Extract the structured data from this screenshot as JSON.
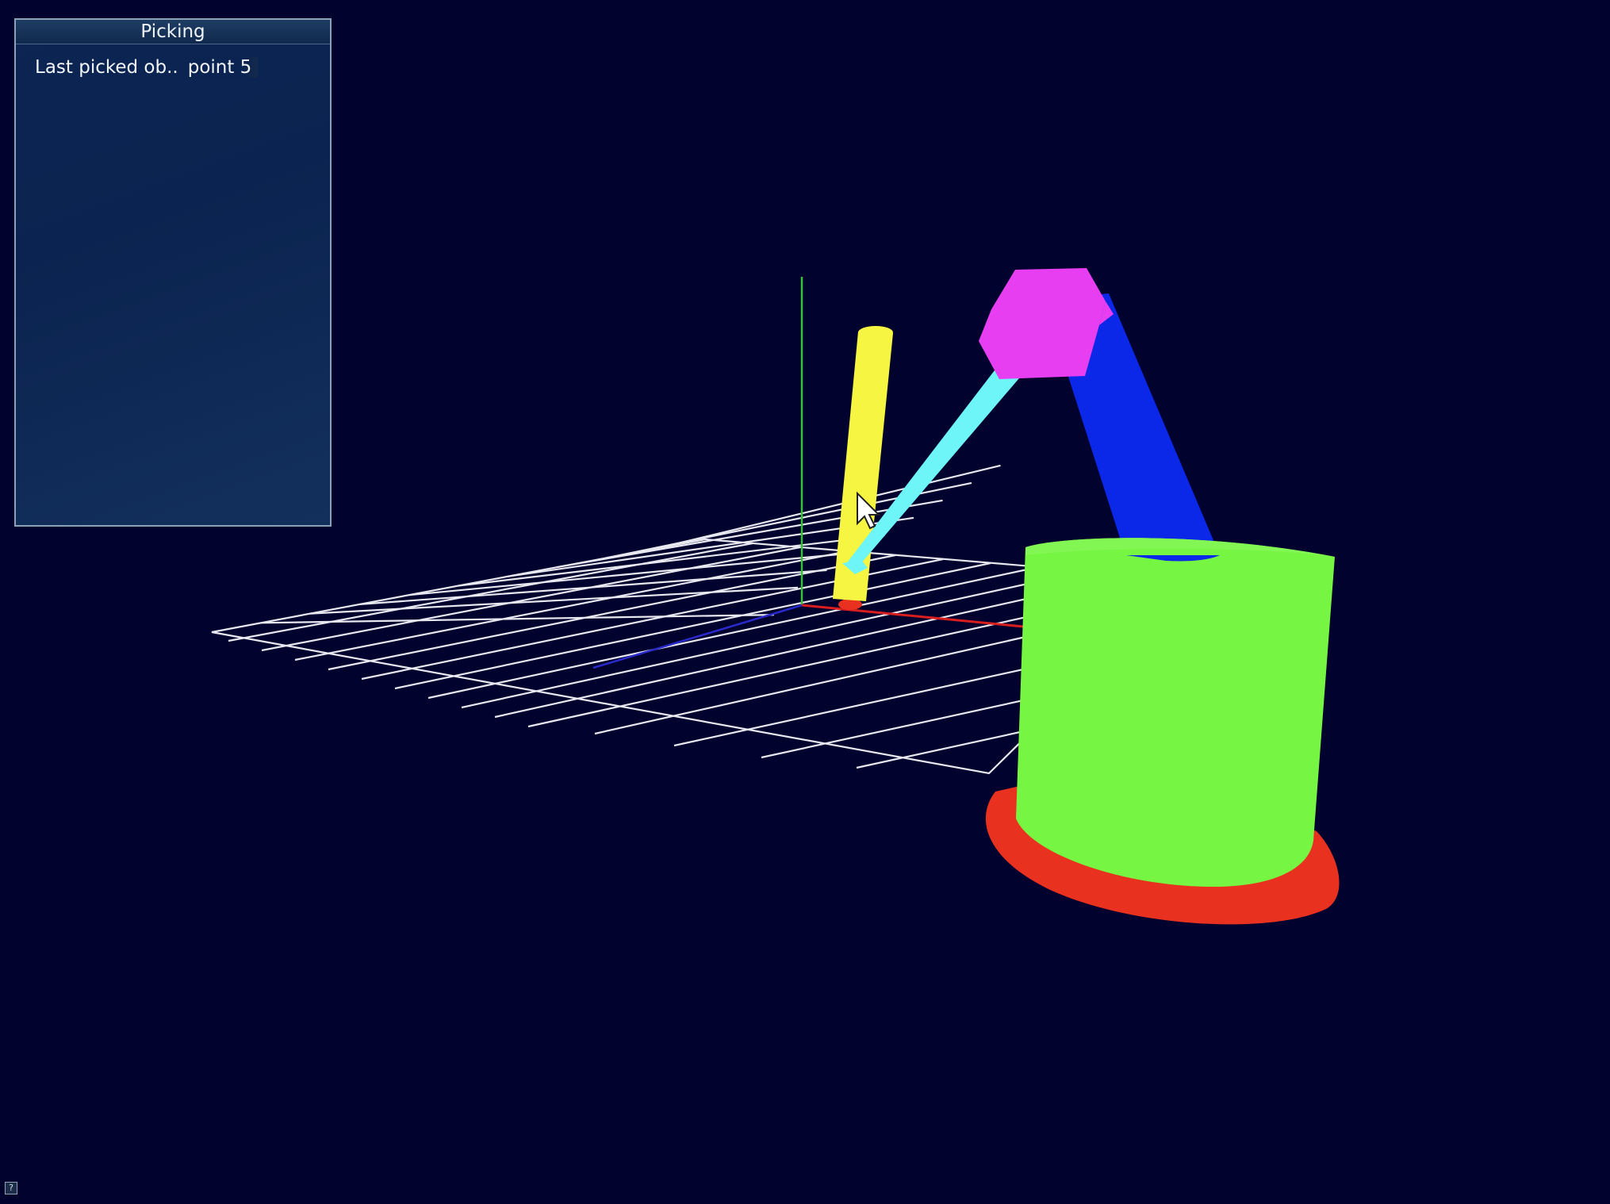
{
  "panel": {
    "title": "Picking",
    "row_label": "Last picked ob..",
    "row_value": "point 5"
  },
  "help": {
    "glyph": "?"
  },
  "scene": {
    "background": "#02022e",
    "grid_color": "#e8e8f0",
    "axis_colors": {
      "x": "#d81e1e",
      "y": "#36c236",
      "z": "#2a2acc"
    },
    "parts": {
      "base_disc": "#e8321f",
      "base_cylinder": "#76f542",
      "upper_arm": "#0b27e8",
      "elbow_joint": "#e83ef2",
      "forearm": "#6df5f7",
      "end_effector": "#f5f542"
    },
    "cursor_icon": "arrow-cursor-icon"
  }
}
